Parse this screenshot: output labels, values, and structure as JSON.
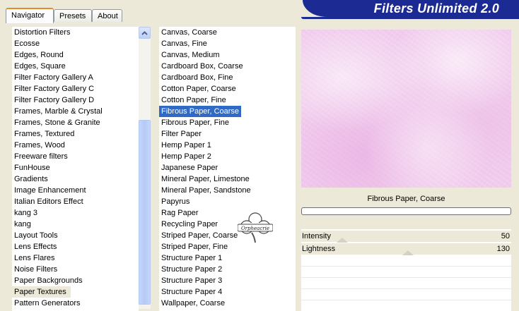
{
  "tabs": [
    {
      "label": "Navigator",
      "active": true
    },
    {
      "label": "Presets",
      "active": false
    },
    {
      "label": "About",
      "active": false
    }
  ],
  "banner": {
    "title": "Filters Unlimited 2.0",
    "color": "#1c2b93"
  },
  "categories": {
    "items": [
      "Distortion Filters",
      "Ecosse",
      "Edges, Round",
      "Edges, Square",
      "Filter Factory Gallery A",
      "Filter Factory Gallery C",
      "Filter Factory Gallery D",
      "Frames, Marble & Crystal",
      "Frames, Stone & Granite",
      "Frames, Textured",
      "Frames, Wood",
      "Freeware filters",
      "FunHouse",
      "Gradients",
      "Image Enhancement",
      "Italian Editors Effect",
      "kang 3",
      "kang",
      "Layout Tools",
      "Lens Effects",
      "Lens Flares",
      "Noise Filters",
      "Paper Backgrounds",
      "Paper Textures",
      "Pattern Generators"
    ],
    "selected": "Paper Textures"
  },
  "filters": {
    "items": [
      "Canvas, Coarse",
      "Canvas, Fine",
      "Canvas, Medium",
      "Cardboard Box, Coarse",
      "Cardboard Box, Fine",
      "Cotton Paper, Coarse",
      "Cotton Paper, Fine",
      "Fibrous Paper, Coarse",
      "Fibrous Paper, Fine",
      "Filter Paper",
      "Hemp Paper 1",
      "Hemp Paper 2",
      "Japanese Paper",
      "Mineral Paper, Limestone",
      "Mineral Paper, Sandstone",
      "Papyrus",
      "Rag Paper",
      "Recycling Paper",
      "Striped Paper, Coarse",
      "Striped Paper, Fine",
      "Structure Paper 1",
      "Structure Paper 2",
      "Structure Paper 3",
      "Structure Paper 4",
      "Wallpaper, Coarse"
    ],
    "selected": "Fibrous Paper, Coarse",
    "selection_color": "#316ac5"
  },
  "preview": {
    "filter_name": "Fibrous Paper, Coarse",
    "tint_color": "#f0c9ec"
  },
  "progress": {
    "value": 0
  },
  "sliders": [
    {
      "label": "Intensity",
      "value": "50",
      "fraction": 0.196
    },
    {
      "label": "Lightness",
      "value": "130",
      "fraction": 0.51
    }
  ],
  "watermark": {
    "text": "Orpheacrie"
  },
  "icons": {
    "scroll_up": "chevron-up-icon"
  }
}
